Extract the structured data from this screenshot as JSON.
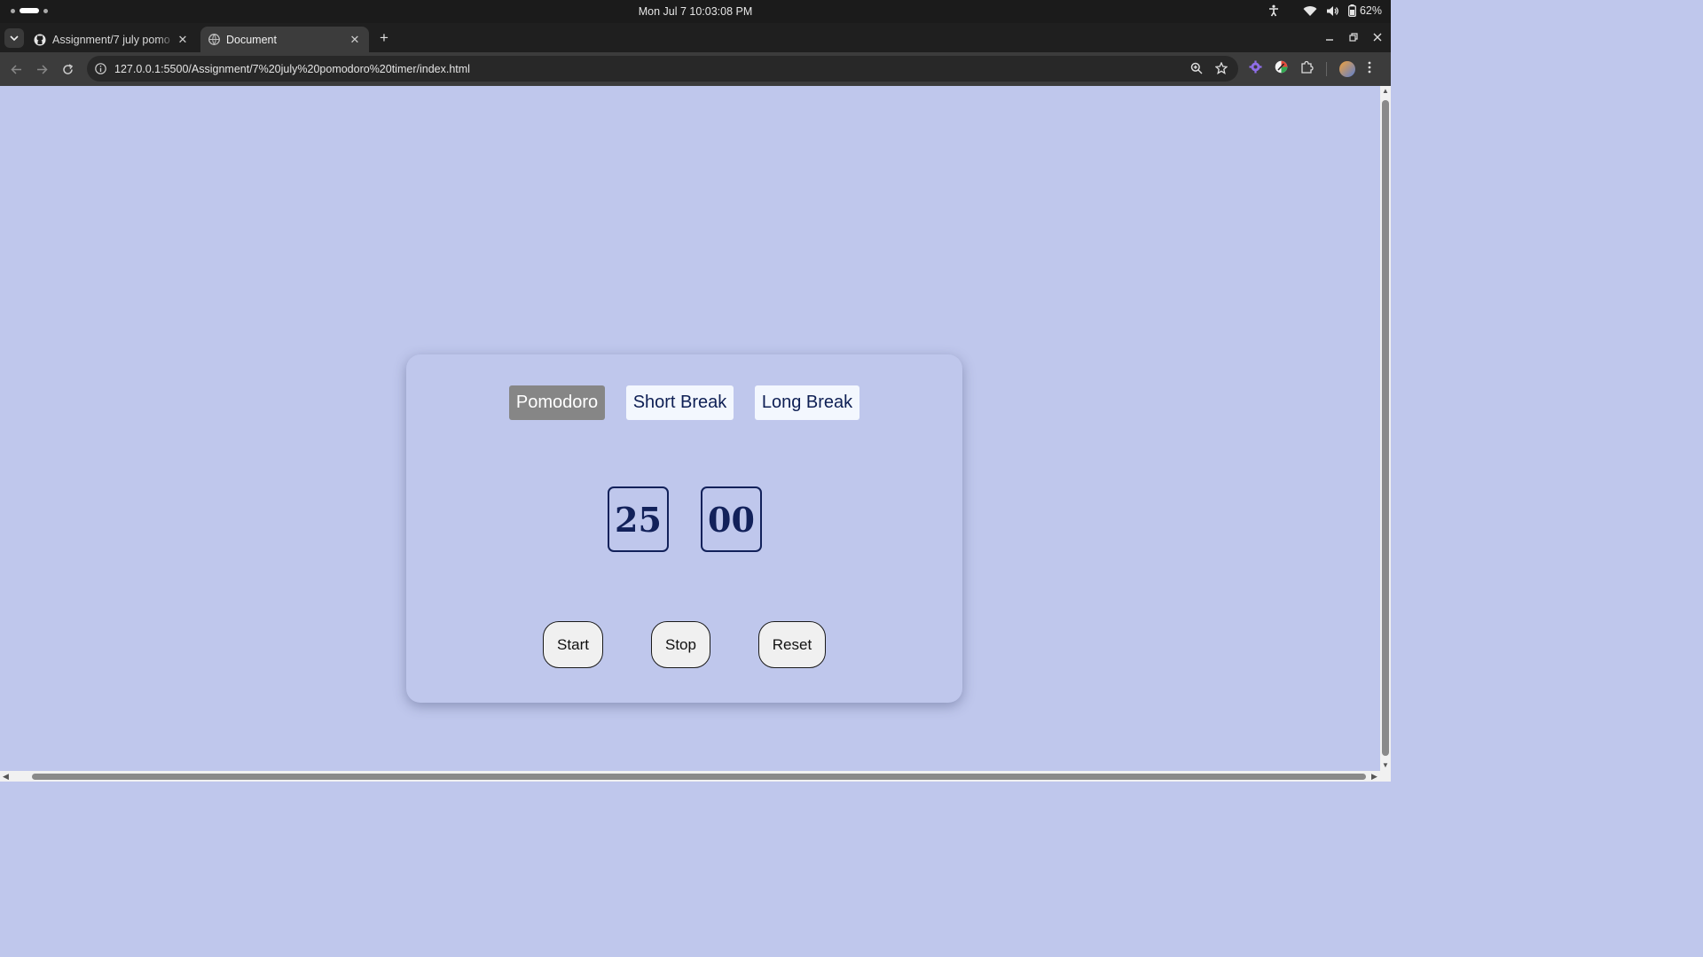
{
  "os": {
    "clock": "Mon Jul 7  10:03:08 PM",
    "battery": "62%"
  },
  "browser": {
    "tabs": [
      {
        "title": "Assignment/7 july pomo",
        "favicon": "github-icon",
        "active": false
      },
      {
        "title": "Document",
        "favicon": "globe-icon",
        "active": true
      }
    ],
    "url": "127.0.0.1:5500/Assignment/7%20july%20pomodoro%20timer/index.html"
  },
  "timer": {
    "modes": {
      "pomodoro": "Pomodoro",
      "short_break": "Short Break",
      "long_break": "Long Break"
    },
    "selected_mode": "pomodoro",
    "minutes": "25",
    "seconds": "00",
    "controls": {
      "start": "Start",
      "stop": "Stop",
      "reset": "Reset"
    }
  },
  "colors": {
    "page_background": "#bfc7ec",
    "selected_mode_bg": "#868686",
    "mode_bg": "#f3f7fe",
    "digit_color": "#12215a"
  }
}
